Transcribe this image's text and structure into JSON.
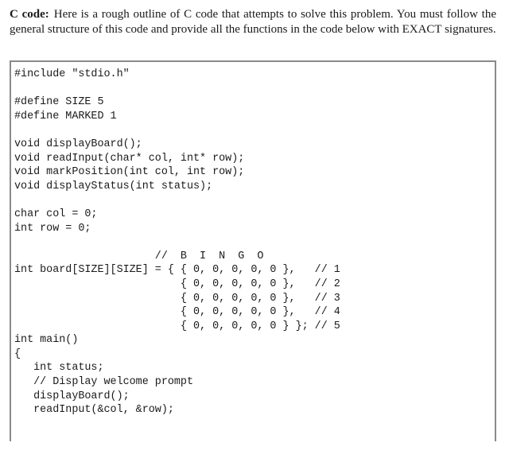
{
  "intro": {
    "lead": "C code:",
    "text": "Here is a rough outline of C code that attempts to solve this problem. You must follow the general structure of this code and provide all the functions in the code below with EXACT signatures."
  },
  "code": {
    "lines": [
      "#include \"stdio.h\"",
      "",
      "#define SIZE 5",
      "#define MARKED 1",
      "",
      "void displayBoard();",
      "void readInput(char* col, int* row);",
      "void markPosition(int col, int row);",
      "void displayStatus(int status);",
      "",
      "char col = 0;",
      "int row = 0;",
      "",
      "                      //  B  I  N  G  O",
      "int board[SIZE][SIZE] = { { 0, 0, 0, 0, 0 },   // 1",
      "                          { 0, 0, 0, 0, 0 },   // 2",
      "                          { 0, 0, 0, 0, 0 },   // 3",
      "                          { 0, 0, 0, 0, 0 },   // 4",
      "                          { 0, 0, 0, 0, 0 } }; // 5",
      "int main()",
      "{",
      "   int status;",
      "   // Display welcome prompt",
      "   displayBoard();",
      "   readInput(&col, &row);"
    ]
  }
}
